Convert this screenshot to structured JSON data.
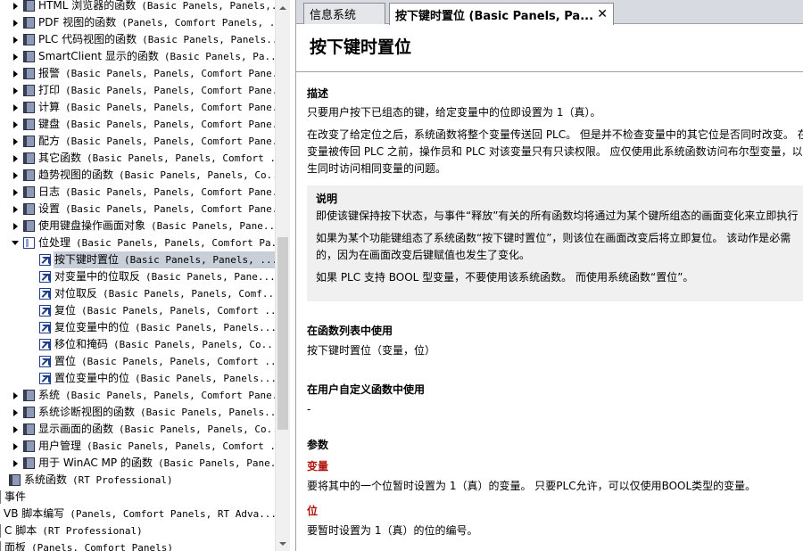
{
  "tree": {
    "items": [
      {
        "label": "HTML 浏览器的函数",
        "suffix": "(Basic Panels, Panels,...",
        "icon": "book-icon",
        "level": 1,
        "arrow": "right"
      },
      {
        "label": "PDF 视图的函数",
        "suffix": "(Panels, Comfort Panels, ...",
        "icon": "book-icon",
        "level": 1,
        "arrow": "right"
      },
      {
        "label": "PLC 代码视图的函数",
        "suffix": "(Basic Panels, Panels...",
        "icon": "book-icon",
        "level": 1,
        "arrow": "right"
      },
      {
        "label": "SmartClient 显示的函数",
        "suffix": "(Basic Panels, Pa...",
        "icon": "book-icon",
        "level": 1,
        "arrow": "right"
      },
      {
        "label": "报警",
        "suffix": "(Basic Panels, Panels, Comfort Pane...",
        "icon": "book-icon",
        "level": 1,
        "arrow": "right"
      },
      {
        "label": "打印",
        "suffix": "(Basic Panels, Panels, Comfort Pane...",
        "icon": "book-icon",
        "level": 1,
        "arrow": "right"
      },
      {
        "label": "计算",
        "suffix": "(Basic Panels, Panels, Comfort Pane...",
        "icon": "book-icon",
        "level": 1,
        "arrow": "right"
      },
      {
        "label": "键盘",
        "suffix": "(Basic Panels, Panels, Comfort Pane...",
        "icon": "book-icon",
        "level": 1,
        "arrow": "right"
      },
      {
        "label": "配方",
        "suffix": "(Basic Panels, Panels, Comfort Pane...",
        "icon": "book-icon",
        "level": 1,
        "arrow": "right"
      },
      {
        "label": "其它函数",
        "suffix": "(Basic Panels, Panels, Comfort ...",
        "icon": "book-icon",
        "level": 1,
        "arrow": "right"
      },
      {
        "label": "趋势视图的函数",
        "suffix": "(Basic Panels, Panels, Co...",
        "icon": "book-icon",
        "level": 1,
        "arrow": "right"
      },
      {
        "label": "日志",
        "suffix": "(Basic Panels, Panels, Comfort Pane...",
        "icon": "book-icon",
        "level": 1,
        "arrow": "right"
      },
      {
        "label": "设置",
        "suffix": "(Basic Panels, Panels, Comfort Pane...",
        "icon": "book-icon",
        "level": 1,
        "arrow": "right"
      },
      {
        "label": "使用键盘操作画面对象",
        "suffix": "(Basic Panels, Pane...",
        "icon": "book-icon",
        "level": 1,
        "arrow": "right"
      },
      {
        "label": "位处理",
        "suffix": "(Basic Panels, Panels, Comfort Pa...",
        "icon": "book-open-icon",
        "level": 1,
        "arrow": "down"
      },
      {
        "label": "按下键时置位",
        "suffix": "(Basic Panels, Panels, ...",
        "icon": "page-icon",
        "level": 2,
        "arrow": "",
        "selected": true
      },
      {
        "label": "对变量中的位取反",
        "suffix": "(Basic Panels, Pane...",
        "icon": "page-icon",
        "level": 2,
        "arrow": ""
      },
      {
        "label": "对位取反",
        "suffix": "(Basic Panels, Panels, Comf...",
        "icon": "page-icon",
        "level": 2,
        "arrow": ""
      },
      {
        "label": "复位",
        "suffix": "(Basic Panels, Panels, Comfort ...",
        "icon": "page-icon",
        "level": 2,
        "arrow": ""
      },
      {
        "label": "复位变量中的位",
        "suffix": "(Basic Panels, Panels...",
        "icon": "page-icon",
        "level": 2,
        "arrow": ""
      },
      {
        "label": "移位和掩码",
        "suffix": "(Basic Panels, Panels, Co...",
        "icon": "page-icon",
        "level": 2,
        "arrow": ""
      },
      {
        "label": "置位",
        "suffix": "(Basic Panels, Panels, Comfort ...",
        "icon": "page-icon",
        "level": 2,
        "arrow": ""
      },
      {
        "label": "置位变量中的位",
        "suffix": "(Basic Panels, Panels...",
        "icon": "page-icon",
        "level": 2,
        "arrow": ""
      },
      {
        "label": "系统",
        "suffix": "(Basic Panels, Panels, Comfort Pane...",
        "icon": "book-icon",
        "level": 1,
        "arrow": "right"
      },
      {
        "label": "系统诊断视图的函数",
        "suffix": "(Basic Panels, Panels...",
        "icon": "book-icon",
        "level": 1,
        "arrow": "right"
      },
      {
        "label": "显示画面的函数",
        "suffix": "(Basic Panels, Panels, Co...",
        "icon": "book-icon",
        "level": 1,
        "arrow": "right"
      },
      {
        "label": "用户管理",
        "suffix": "(Basic Panels, Panels, Comfort ...",
        "icon": "book-icon",
        "level": 1,
        "arrow": "right"
      },
      {
        "label": "用于 WinAC MP 的函数",
        "suffix": "(Basic Panels, Pane...",
        "icon": "book-icon",
        "level": 1,
        "arrow": "right"
      },
      {
        "label": "系统函数",
        "suffix": "(RT Professional)",
        "icon": "book-icon",
        "level": 0,
        "arrow": ""
      },
      {
        "label": "事件",
        "suffix": "",
        "icon": "",
        "level": -1,
        "arrow": ""
      },
      {
        "label": "VB 脚本编写",
        "suffix": "(Panels, Comfort Panels, RT Adva...",
        "icon": "",
        "level": -1,
        "arrow": ""
      },
      {
        "label": "C 脚本",
        "suffix": "(RT Professional)",
        "icon": "",
        "level": -1,
        "arrow": ""
      },
      {
        "label": "面板",
        "suffix": "(Panels, Comfort Panels)",
        "icon": "",
        "level": -1,
        "arrow": ""
      }
    ]
  },
  "tabs": [
    {
      "label": "信息系统"
    },
    {
      "label": "按下键时置位 (Basic Panels, Pa...",
      "close": "✕"
    }
  ],
  "doc": {
    "title": "按下键时置位",
    "desc_heading": "描述",
    "desc_p1": "只要用户按下已组态的键，给定变量中的位即设置为 1（真）。",
    "desc_p2_l1": "在改变了给定位之后，系统函数将整个变量传送回 PLC。 但是并不检查变量中的其它位是否同时改变。 在",
    "desc_p2_l2": "变量被传回 PLC 之前，操作员和 PLC 对该变量只有只读权限。 应仅使用此系统函数访问布尔型变量，以避",
    "desc_p2_l3": "生同时访问相同变量的问题。",
    "note_heading": "说明",
    "note_p1": "即使该键保持按下状态，与事件“释放”有关的所有函数均将通过为某个键所组态的画面变化来立即执行",
    "note_p2_l1": "如果为某个功能键组态了系统函数“按下键时置位”，则该位在画面改变后将立即复位。 该动作是必需",
    "note_p2_l2": "的，因为在画面改变后键赋值也发生了变化。",
    "note_p3": "如果 PLC 支持 BOOL 型变量，不要使用该系统函数。 而使用系统函数“置位”。",
    "funclist_heading": "在函数列表中使用",
    "funclist_text": "按下键时置位（变量，位）",
    "userfunc_heading": "在用户自定义函数中使用",
    "userfunc_text": "-",
    "params_heading": "参数",
    "param1_name": "变量",
    "param1_text": "要将其中的一个位暂时设置为 1（真）的变量。 只要PLC允许，可以仅使用BOOL类型的变量。",
    "param2_name": "位",
    "param2_text": "要暂时设置为 1（真）的位的编号。"
  }
}
